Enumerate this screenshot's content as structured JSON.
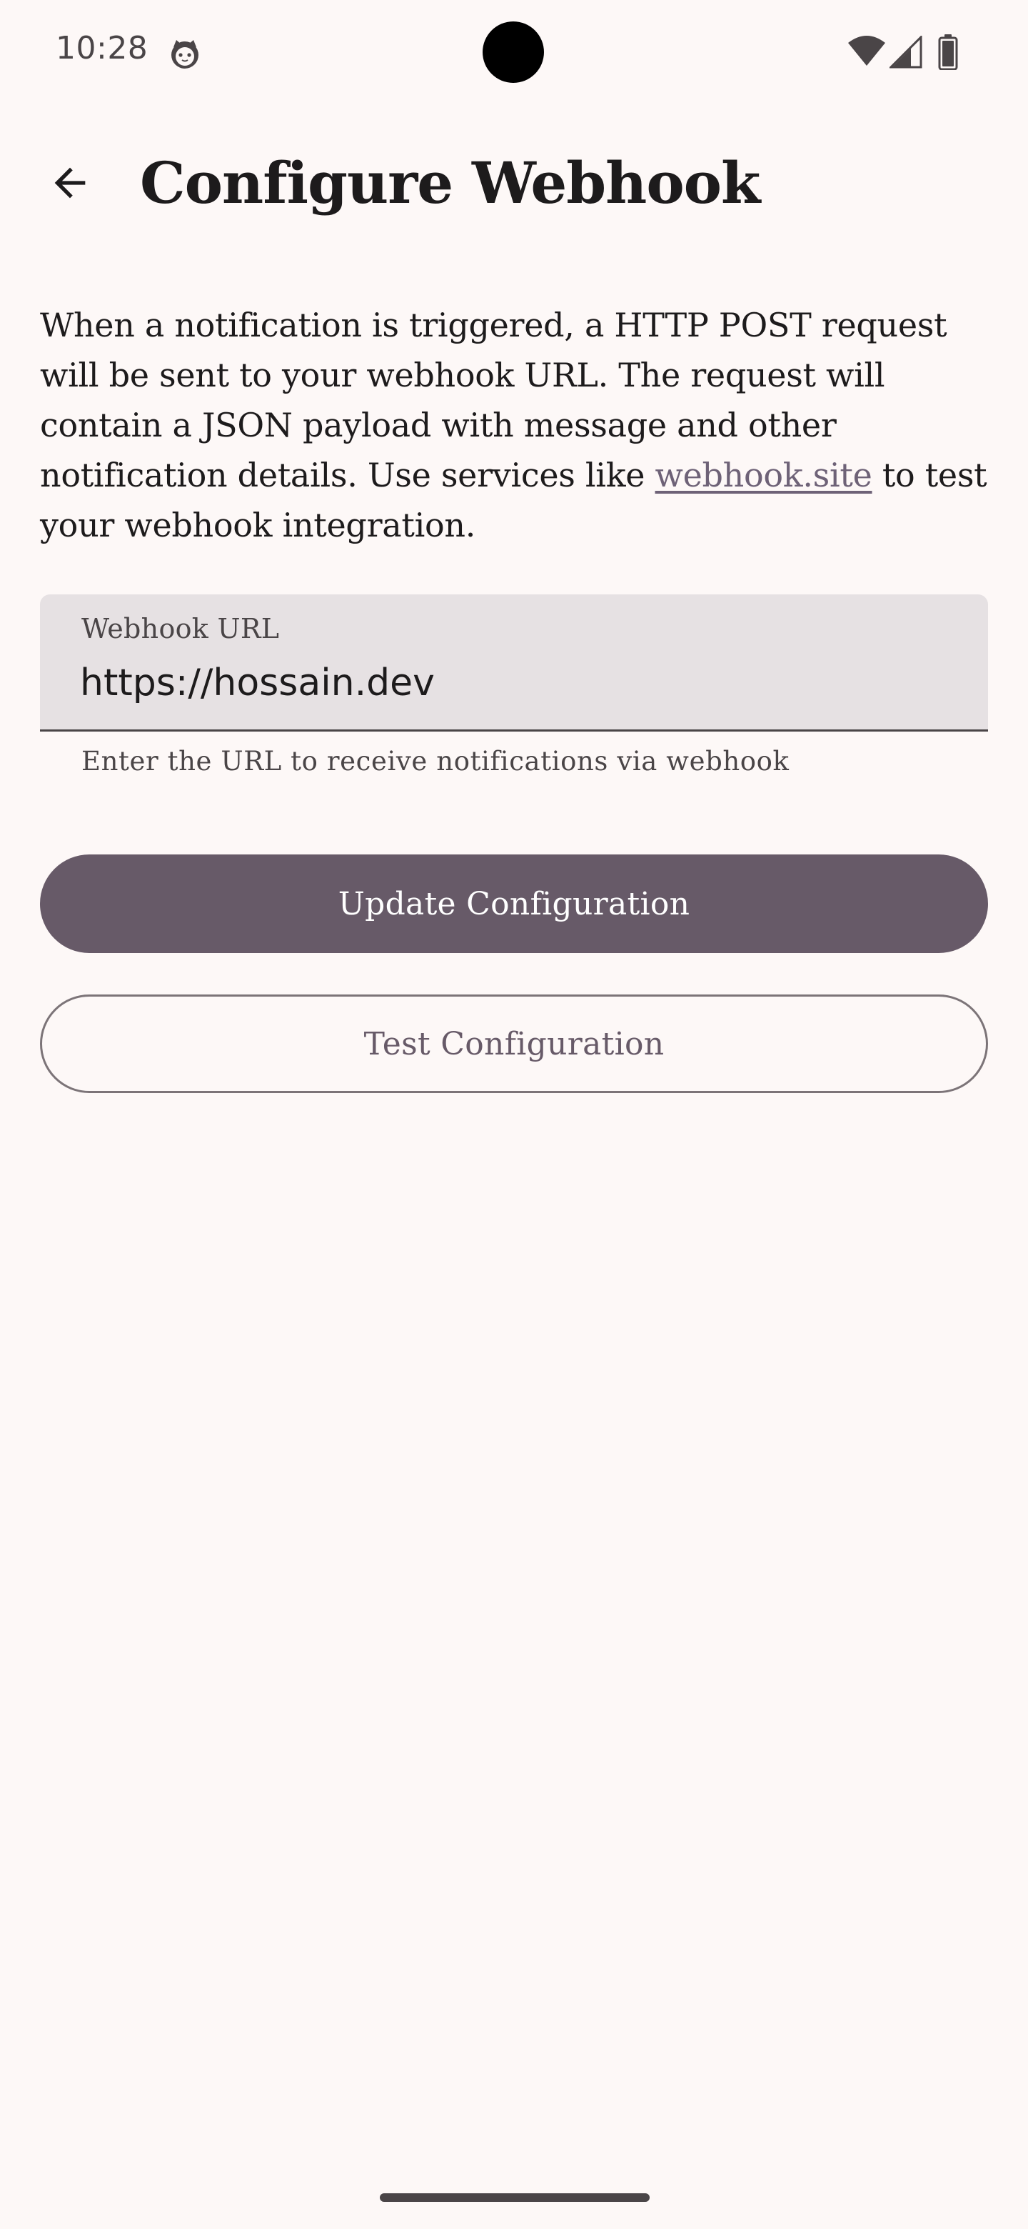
{
  "status_bar": {
    "time": "10:28",
    "notification_icon": "cat-face-icon",
    "wifi_icon": "wifi-icon",
    "signal_icon": "cellular-signal-icon",
    "battery_icon": "battery-icon"
  },
  "app_bar": {
    "back_icon": "arrow-back-icon",
    "title": "Configure Webhook"
  },
  "description": {
    "before_link": "When a notification is triggered, a HTTP POST request will be sent to your webhook URL. The request will contain a JSON payload with message and other notification details. Use services like ",
    "link_text": "webhook.site",
    "after_link": " to test your webhook integration."
  },
  "webhook_field": {
    "label": "Webhook URL",
    "value": "https://hossain.dev",
    "supporting_text": "Enter the URL to receive notifications via webhook"
  },
  "buttons": {
    "update_label": "Update Configuration",
    "test_label": "Test Configuration"
  },
  "colors": {
    "background": "#fdf8f7",
    "primary": "#675a68",
    "link": "#6e6277",
    "field_background": "#e6e1e3"
  }
}
